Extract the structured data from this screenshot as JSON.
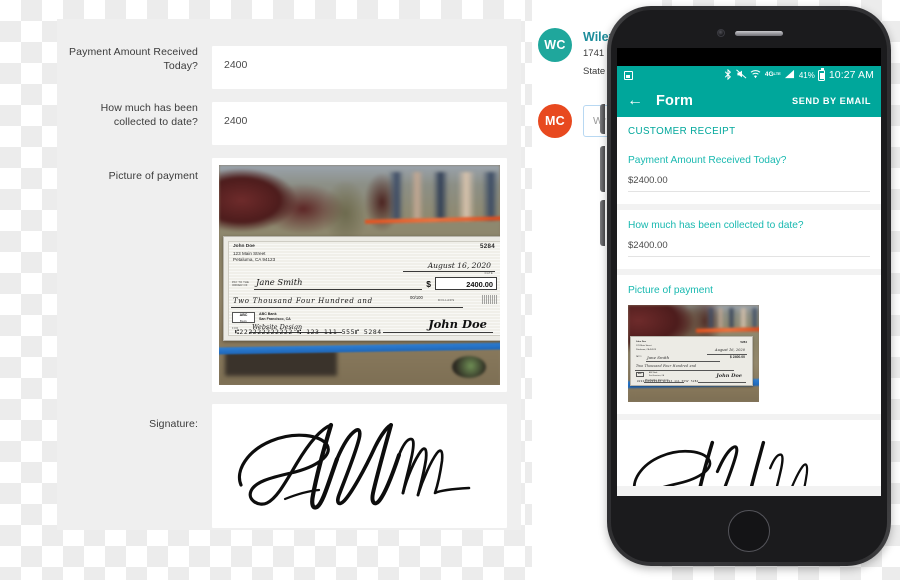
{
  "desktop_form": {
    "fields": [
      {
        "label": "Payment Amount Received Today?",
        "value": "2400"
      },
      {
        "label": "How much has been collected to date?",
        "value": "2400"
      },
      {
        "label": "Picture of payment",
        "value": ""
      },
      {
        "label": "Signature:",
        "value": ""
      }
    ]
  },
  "check": {
    "drawer_name": "John Doe",
    "drawer_street": "123 Main Street",
    "drawer_city": "Petaluma, CA 94123",
    "check_number": "5284",
    "date": "August 16, 2020",
    "date_label": "DATE",
    "pay_to_label": "PAY TO THE ORDER OF",
    "payee": "Jane Smith",
    "dollar_sign": "$",
    "amount": "2400.00",
    "amount_words": "Two Thousand Four Hundred and",
    "fraction": "00/100",
    "dollars_label": "DOLLARS",
    "bank_logo": "ABC",
    "bank_logo_sub": "Bank",
    "bank_name": "ABC Bank",
    "bank_city": "San Francisco, CA",
    "for_label": "FOR",
    "memo": "Website Design",
    "signature": "John Doe",
    "micr": "⑆222222222222 ⑆ 123   111   555⑈ 5284"
  },
  "chat": {
    "items": [
      {
        "initials": "WC",
        "color": "#1fa79c",
        "title": "Wiley",
        "line1": "1741",
        "line2": "State"
      },
      {
        "initials": "MC",
        "color": "#e8491f",
        "title": "",
        "input_placeholder": "Wr"
      }
    ]
  },
  "phone": {
    "statusbar": {
      "image_icon": "image-icon",
      "bluetooth_icon": "bluetooth-icon",
      "mute_icon": "vibrate-mute-icon",
      "wifi_icon": "wifi-icon",
      "network_label": "4G",
      "network_sub": "LTE",
      "signal_icon": "signal-bars-icon",
      "battery_percent": "41%",
      "battery_icon": "battery-icon",
      "time": "10:27 AM"
    },
    "appbar": {
      "back_icon": "back-arrow-icon",
      "title": "Form",
      "action": "SEND BY EMAIL"
    },
    "section_title": "CUSTOMER RECEIPT",
    "cards": [
      {
        "question": "Payment Amount Received Today?",
        "answer": "$2400.00"
      },
      {
        "question": "How much has been collected to date?",
        "answer": "$2400.00"
      },
      {
        "question": "Picture of payment",
        "answer": ""
      }
    ],
    "home_button_icon": "home-button"
  },
  "colors": {
    "teal": "#00a79b",
    "teal_light": "#19b9b0",
    "orange": "#e8491f",
    "panel_gray": "#efefef"
  }
}
